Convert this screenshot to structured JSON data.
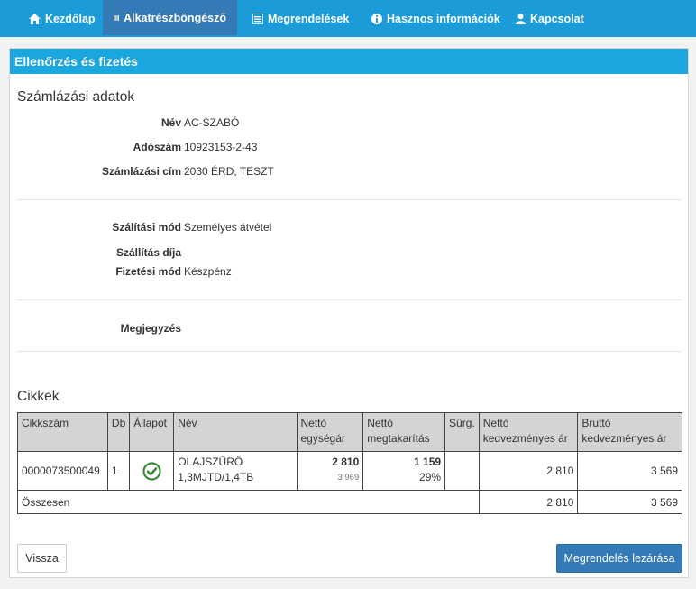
{
  "nav": {
    "items": [
      {
        "label": "Kezdőlap",
        "icon": "home-icon"
      },
      {
        "label": "Alkatrészböngésző",
        "icon": "barcode-icon",
        "active": true
      },
      {
        "label": "Megrendelések",
        "icon": "list-icon"
      },
      {
        "label": "Hasznos információk",
        "icon": "info-icon"
      },
      {
        "label": "Kapcsolat",
        "icon": "user-icon"
      }
    ]
  },
  "panel": {
    "title": "Ellenőrzés és fizetés"
  },
  "billing": {
    "title": "Számlázási adatok",
    "name_label": "Név",
    "name_value": "AC-SZABÓ",
    "tax_label": "Adószám",
    "tax_value": "10923153-2-43",
    "address_label": "Számlázási cím",
    "address_value": "2030 ÉRD, TESZT"
  },
  "shipping": {
    "mode_label": "Szálítási mód",
    "mode_value": "Személyes átvétel",
    "fee_label": "Szállítás díja",
    "fee_value": "",
    "payment_label": "Fizetési mód",
    "payment_value": "Készpénz"
  },
  "note": {
    "label": "Megjegyzés",
    "value": ""
  },
  "items": {
    "title": "Cikkek",
    "columns": {
      "sku": "Cikkszám",
      "qty": "Db",
      "status": "Állapot",
      "name": "Név",
      "net_unit_1": "Nettó",
      "net_unit_2": "egységár",
      "net_saving_1": "Nettó",
      "net_saving_2": "megtakarítás",
      "urgent": "Sürg.",
      "net_disc_1": "Nettó",
      "net_disc_2": "kedvezményes ár",
      "gross_disc_1": "Bruttó",
      "gross_disc_2": "kedvezményes ár"
    },
    "rows": [
      {
        "sku": "0000073500049",
        "qty": "1",
        "status_icon": "check-circle-icon",
        "name_line1": "OLAJSZŰRŐ",
        "name_line2": "1,3MJTD/1,4TB",
        "net_unit": "2 810",
        "net_unit_orig": "3 969",
        "saving": "1 159",
        "saving_pct": "29%",
        "urgent": "",
        "net_discounted": "2 810",
        "gross_discounted": "3 569"
      }
    ],
    "total_label": "Összesen",
    "total_net": "2 810",
    "total_gross": "3 569"
  },
  "buttons": {
    "back": "Vissza",
    "submit": "Megrendelés lezárása"
  },
  "colors": {
    "navbar": "#1b9bd8",
    "nav_active": "#337ab7",
    "panel_header": "#1aa7e0",
    "primary_button": "#337ab7",
    "status_ok": "#3a8a3a"
  }
}
